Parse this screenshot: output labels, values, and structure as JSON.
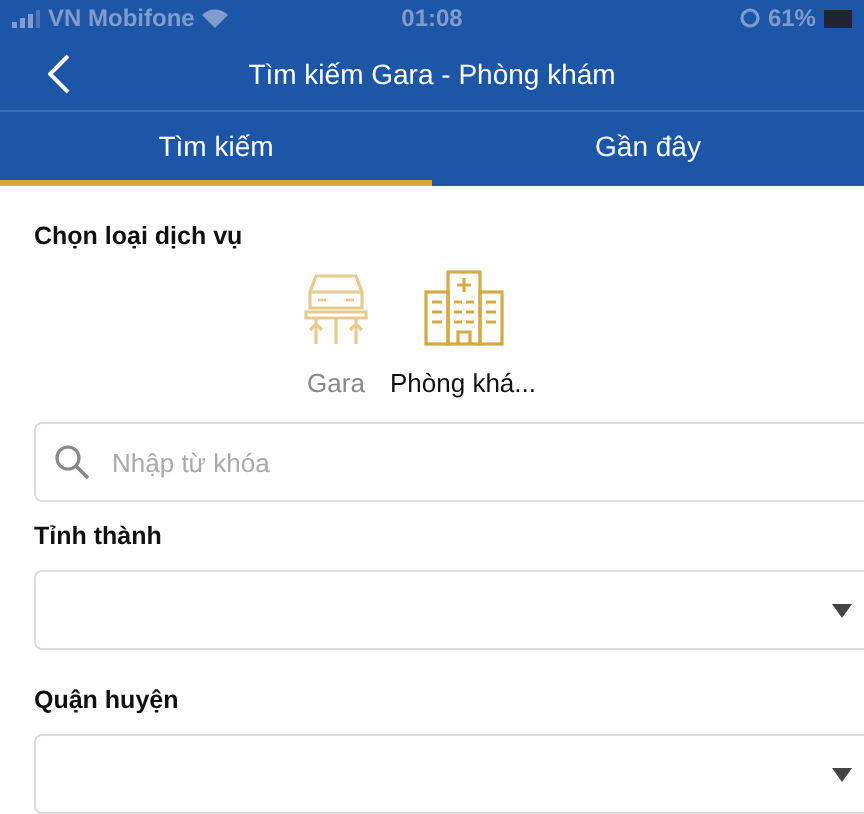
{
  "status_bar": {
    "carrier": "VN Mobifone",
    "time": "01:08",
    "battery": "61%"
  },
  "header": {
    "title": "Tìm kiếm Gara - Phòng khám"
  },
  "tabs": [
    {
      "label": "Tìm kiếm",
      "selected": true
    },
    {
      "label": "Gần đây",
      "selected": false
    }
  ],
  "service_section": {
    "label": "Chọn loại dịch vụ",
    "services": [
      {
        "kind": "garage",
        "label": "Gara",
        "selected": false
      },
      {
        "kind": "clinic",
        "label": "Phòng khá...",
        "selected": true
      }
    ]
  },
  "search": {
    "placeholder": "Nhập từ khóa"
  },
  "selects": [
    {
      "label": "Tỉnh thành"
    },
    {
      "label": "Quận huyện"
    }
  ]
}
